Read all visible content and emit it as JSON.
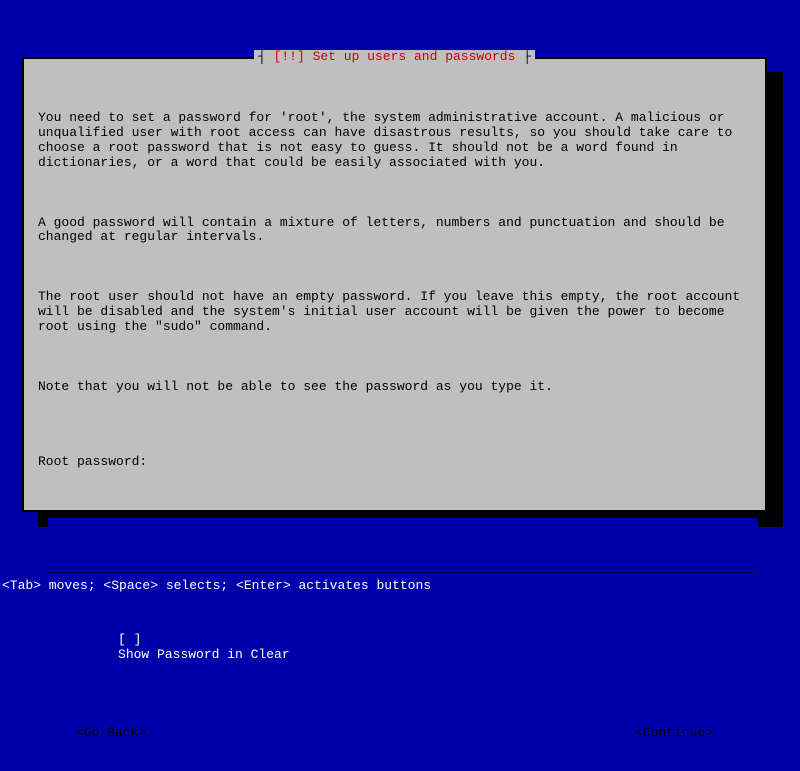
{
  "dialog": {
    "title_prefix": "┤ ",
    "title_warn": "[!!] ",
    "title_text": "Set up users and passwords",
    "title_suffix": " ├",
    "paragraphs": [
      "You need to set a password for 'root', the system administrative account. A malicious or unqualified user with root access can have disastrous results, so you should take care to choose a root password that is not easy to guess. It should not be a word found in dictionaries, or a word that could be easily associated with you.",
      "A good password will contain a mixture of letters, numbers and punctuation and should be changed at regular intervals.",
      "The root user should not have an empty password. If you leave this empty, the root account will be disabled and the system's initial user account will be given the power to become root using the \"sudo\" command.",
      "Note that you will not be able to see the password as you type it."
    ],
    "prompt_label": "Root password:",
    "input_value": "",
    "underline": "________________________________________________________________________________________",
    "checkbox": {
      "state": "[ ]",
      "label": "Show Password in Clear"
    },
    "buttons": {
      "back": "<Go Back>",
      "continue": "<Continue>"
    }
  },
  "footer": "<Tab> moves; <Space> selects; <Enter> activates buttons"
}
